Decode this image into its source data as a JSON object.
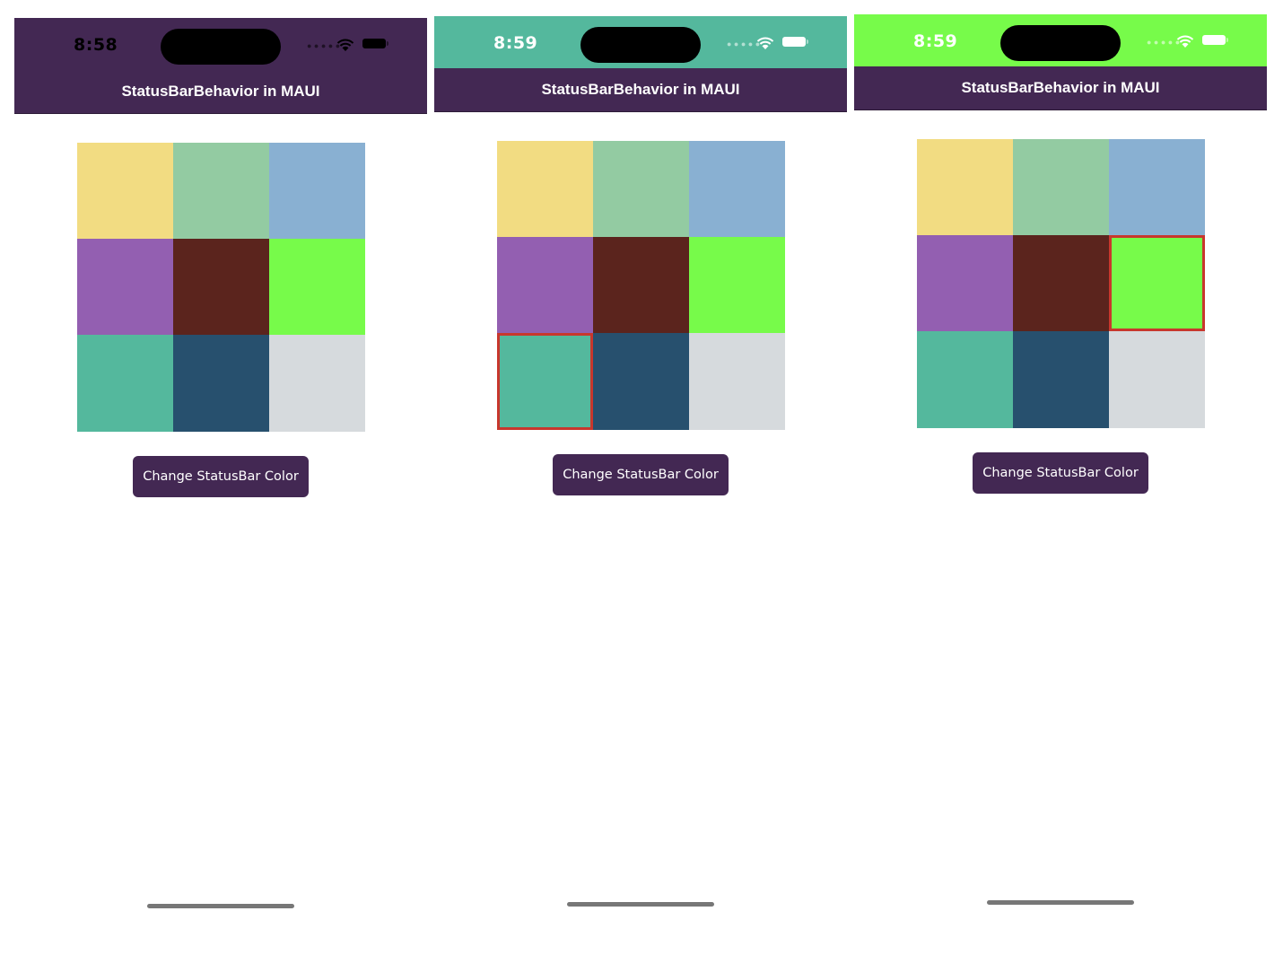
{
  "screens": [
    {
      "time": "8:58",
      "status_bg": "#432853",
      "status_fg": "#000000",
      "nav_title": "StatusBarBehavior in MAUI",
      "button_label": "Change StatusBar Color",
      "selected_index": -1
    },
    {
      "time": "8:59",
      "status_bg": "#54B89D",
      "status_fg": "#ffffff",
      "nav_title": "StatusBarBehavior in MAUI",
      "button_label": "Change StatusBar Color",
      "selected_index": 6
    },
    {
      "time": "8:59",
      "status_bg": "#77FB4A",
      "status_fg": "#ffffff",
      "nav_title": "StatusBarBehavior in MAUI",
      "button_label": "Change StatusBar Color",
      "selected_index": 5
    }
  ],
  "palette": [
    "#F2DC82",
    "#93CBA2",
    "#89B0D2",
    "#935FB1",
    "#5B241D",
    "#77FB4A",
    "#54B89D",
    "#27506E",
    "#D6DADD"
  ],
  "colors": {
    "nav_bg": "#432853",
    "button_bg": "#432853",
    "selection_border": "#c8372d"
  },
  "icons": [
    "signal-icon",
    "wifi-icon",
    "battery-icon"
  ]
}
